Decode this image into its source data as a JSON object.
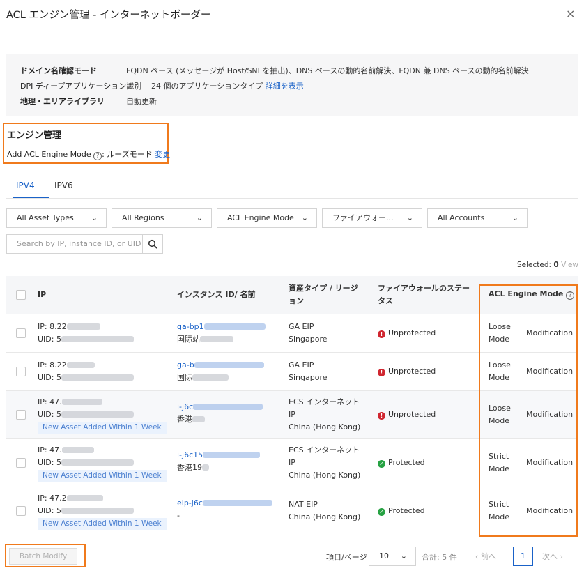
{
  "window": {
    "title": "ACL エンジン管理 - インターネットボーダー",
    "close": "×"
  },
  "info": {
    "rows": [
      {
        "label": "ドメイン名確認モード",
        "value": "FQDN ベース (メッセージが Host/SNI を抽出)、DNS ベースの動的名前解決、FQDN 兼 DNS ベースの動的名前解決"
      },
      {
        "label": "DPI ディープアプリケーション識別",
        "value": "24 個のアプリケーションタイプ",
        "link": "詳細を表示"
      },
      {
        "label": "地理・エリアライブラリ",
        "value": "自動更新"
      }
    ]
  },
  "engine": {
    "title": "エンジン管理",
    "mode_label": "Add ACL Engine Mode",
    "help": "?",
    "mode_value": ": ルーズモード",
    "change": "変更"
  },
  "tabs": [
    {
      "label": "IPV4",
      "active": true
    },
    {
      "label": "IPV6",
      "active": false
    }
  ],
  "filters": [
    "All Asset Types",
    "All Regions",
    "ACL Engine Mode",
    "ファイアウォー...",
    "All Accounts"
  ],
  "search": {
    "placeholder": "Search by IP, instance ID, or UID"
  },
  "selection": {
    "label": "Selected: ",
    "count": "0",
    "view": "View"
  },
  "table": {
    "headers": {
      "ip": "IP",
      "instance_1": "インスタンス ID/ 名前",
      "asset_1": "資産タイプ / リージ",
      "asset_2": "ョン",
      "fw_1": "ファイアウォールのステー",
      "fw_2": "タス",
      "mode": "ACL Engine Mode",
      "mode_help": "?"
    },
    "rows": [
      {
        "ip": "IP: 8.22",
        "uid": "UID: 5",
        "tag": "",
        "inst_id": "ga-bp1",
        "inst_name": "国际站",
        "asset_1": "GA EIP",
        "asset_2": "Singapore",
        "asset_3": "",
        "status": "Unprotected",
        "mode_1": "Loose",
        "mode_2": "Mode",
        "action": "Modification"
      },
      {
        "ip": "IP: 8.22",
        "uid": "UID: 5",
        "tag": "",
        "inst_id": "ga-b",
        "inst_name": "国际",
        "asset_1": "GA EIP",
        "asset_2": "Singapore",
        "asset_3": "",
        "status": "Unprotected",
        "mode_1": "Loose",
        "mode_2": "Mode",
        "action": "Modification"
      },
      {
        "ip": "IP: 47.",
        "uid": "UID: 5",
        "tag": "New Asset Added Within 1 Week",
        "inst_id": "i-j6c",
        "inst_name": "香港",
        "asset_1": "ECS インターネット",
        "asset_2": "IP",
        "asset_3": "China (Hong Kong)",
        "status": "Unprotected",
        "mode_1": "Loose",
        "mode_2": "Mode",
        "action": "Modification"
      },
      {
        "ip": "IP: 47.",
        "uid": "UID: 5",
        "tag": "New Asset Added Within 1 Week",
        "inst_id": "i-j6c15",
        "inst_name": "香港19",
        "asset_1": "ECS インターネット",
        "asset_2": "IP",
        "asset_3": "China (Hong Kong)",
        "status": "Protected",
        "mode_1": "Strict",
        "mode_2": "Mode",
        "action": "Modification"
      },
      {
        "ip": "IP: 47.2",
        "uid": "UID: 5",
        "tag": "New Asset Added Within 1 Week",
        "inst_id": "eip-j6c",
        "inst_name": "-",
        "asset_1": "NAT EIP",
        "asset_2": "China (Hong Kong)",
        "asset_3": "",
        "status": "Protected",
        "mode_1": "Strict",
        "mode_2": "Mode",
        "action": "Modification"
      }
    ]
  },
  "footer": {
    "batch": "Batch Modify",
    "page_size_label": "項目/ページ",
    "page_size": "10",
    "total": "合計: 5 件",
    "prev": "前へ",
    "page": "1",
    "next": "次へ"
  },
  "colors": {
    "accent": "#1a62c8",
    "highlight": "#f07a1c",
    "danger": "#d0262f",
    "success": "#27a243"
  },
  "icons": {
    "close": "close-icon",
    "search": "search-icon",
    "help": "question-circle-icon",
    "chevron": "chevron-down-icon",
    "unprotected": "error-circle-icon",
    "protected": "check-circle-icon"
  }
}
